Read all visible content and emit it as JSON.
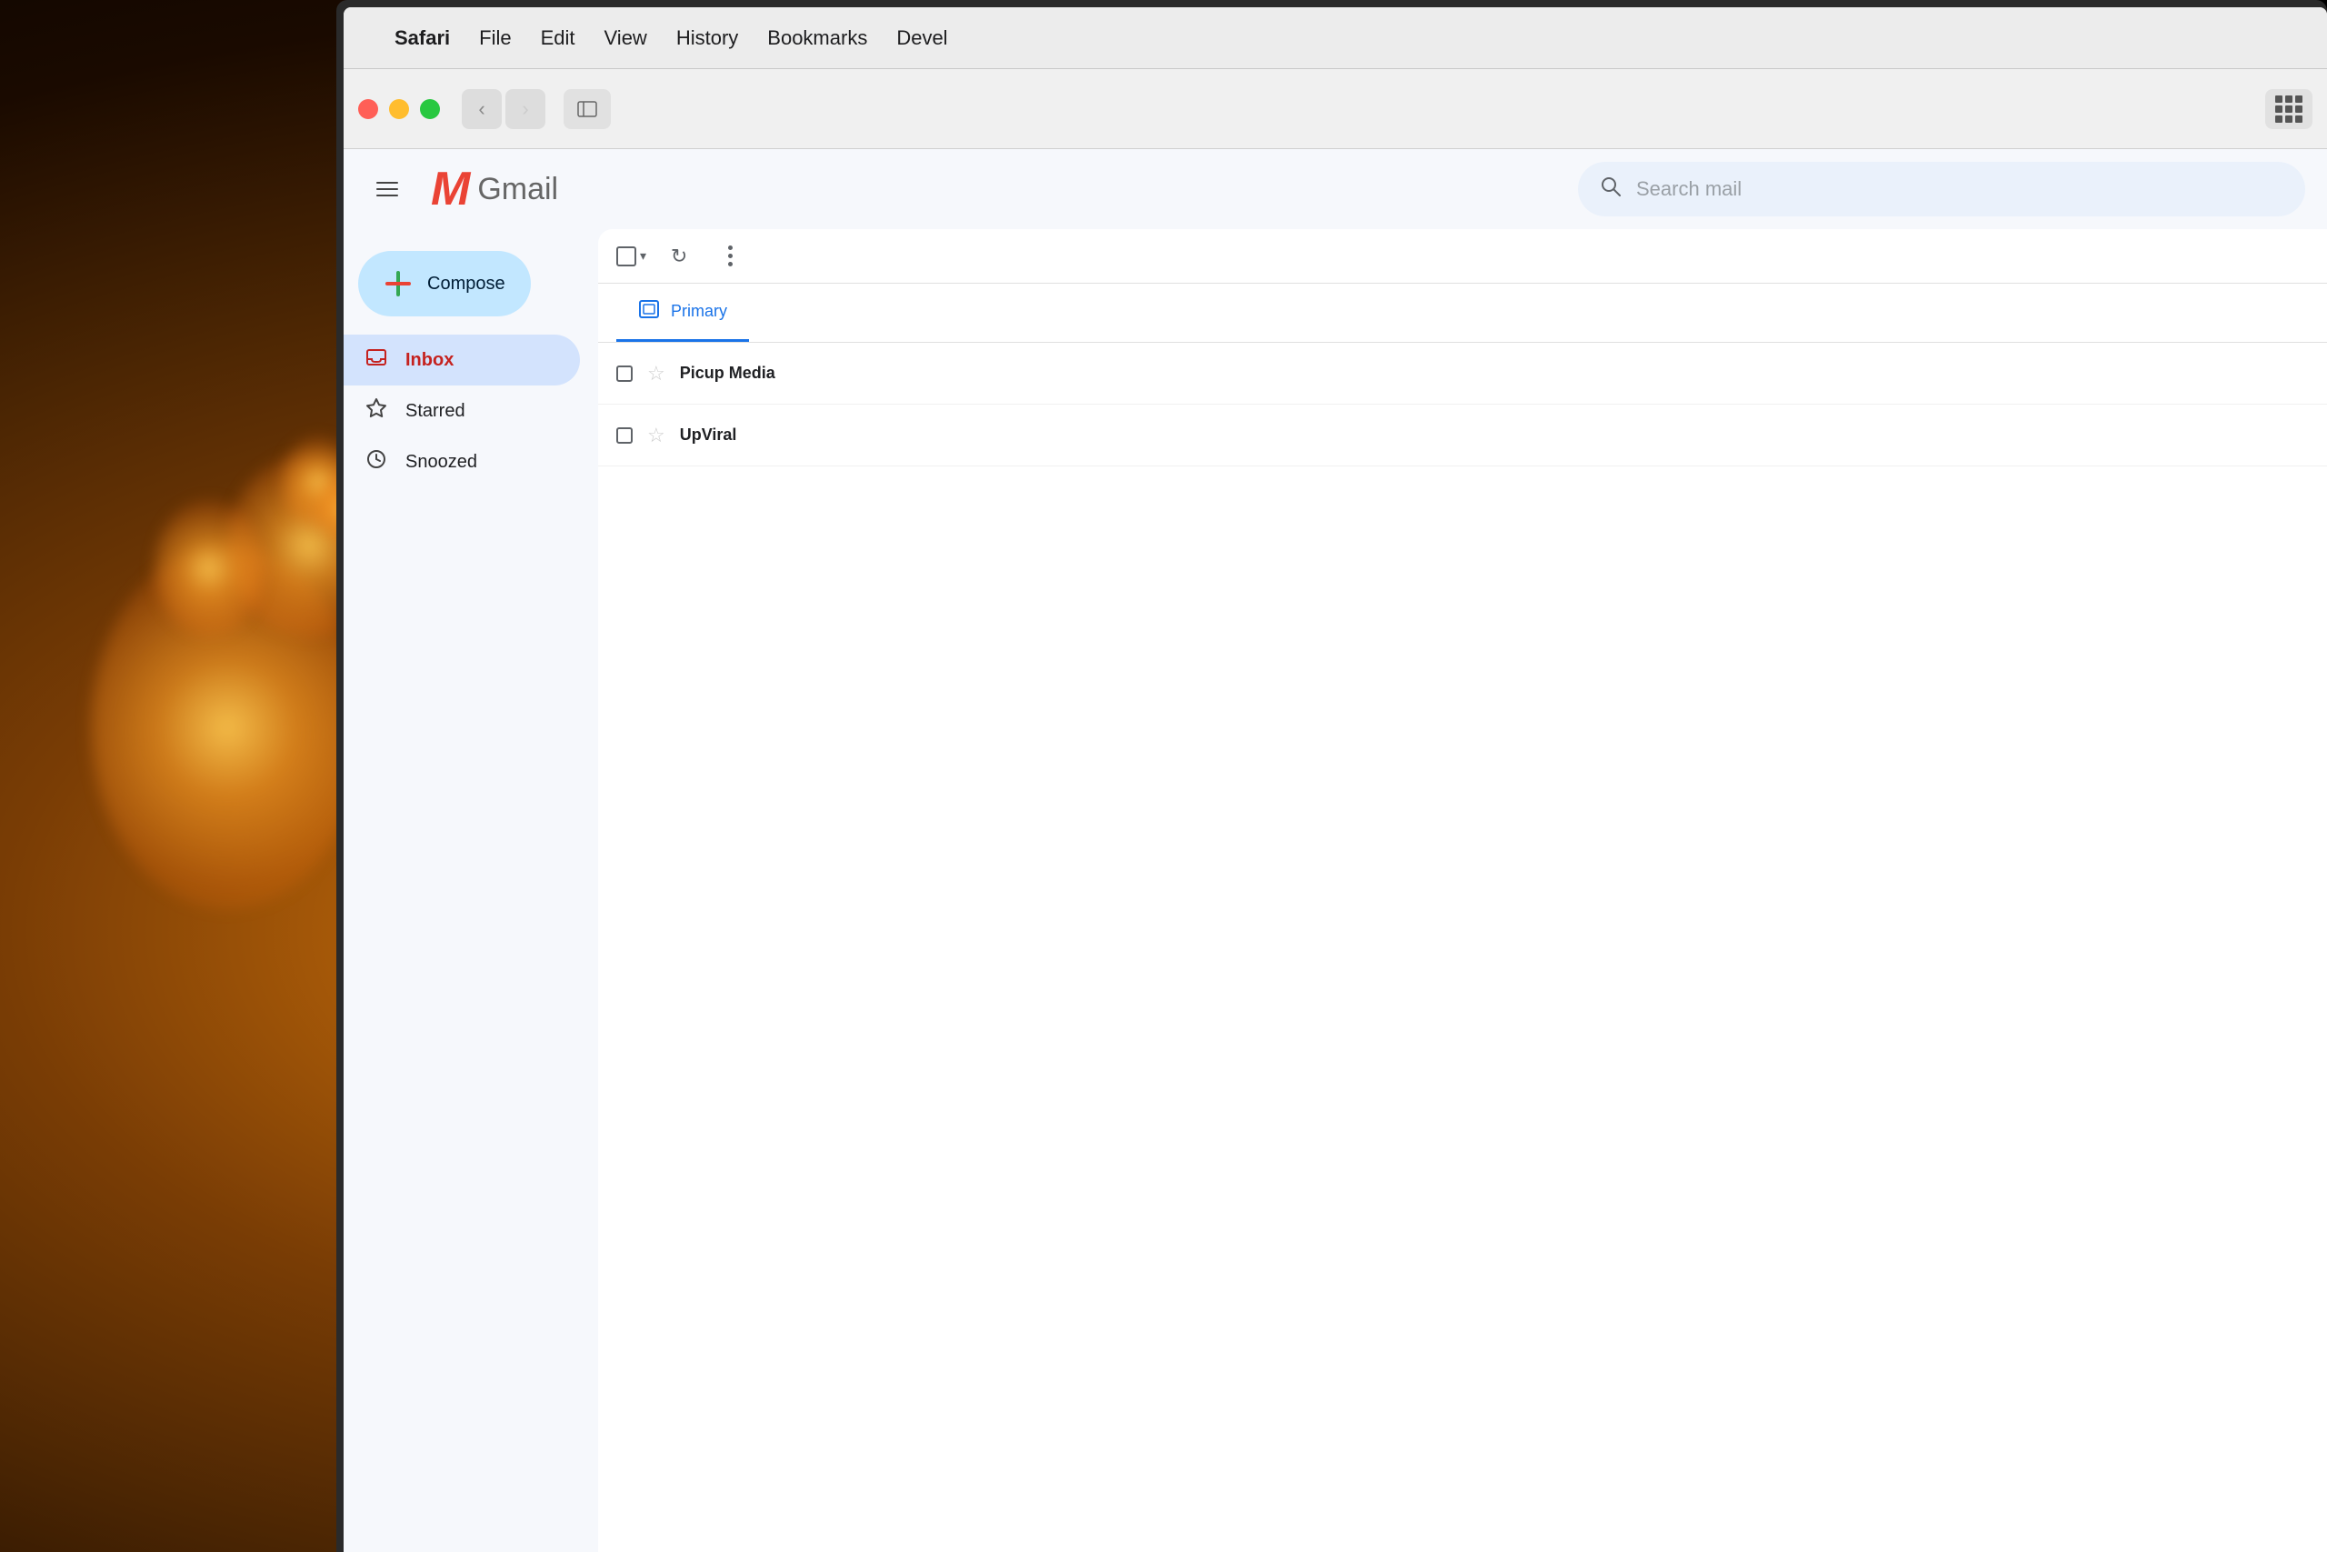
{
  "background": {
    "color": "#1a1a1a"
  },
  "menubar": {
    "app_name": "Safari",
    "items": [
      "File",
      "Edit",
      "View",
      "History",
      "Bookmarks",
      "Devel"
    ]
  },
  "browser": {
    "back_icon": "‹",
    "forward_icon": "›",
    "sidebar_icon": "⊞",
    "grid_icon": "grid"
  },
  "gmail": {
    "menu_icon": "≡",
    "logo_letter": "M",
    "logo_text": "Gmail",
    "search_placeholder": "Search mail",
    "compose_label": "Compose",
    "nav_items": [
      {
        "label": "Inbox",
        "icon": "inbox",
        "active": true
      },
      {
        "label": "Starred",
        "icon": "star"
      },
      {
        "label": "Snoozed",
        "icon": "clock"
      }
    ],
    "toolbar": {
      "refresh_icon": "↻",
      "more_icon": "⋮"
    },
    "tabs": [
      {
        "label": "Primary",
        "icon": "□",
        "active": true
      }
    ],
    "emails": [
      {
        "sender": "Picup Media",
        "star": "☆"
      },
      {
        "sender": "UpViral",
        "star": "☆"
      }
    ]
  }
}
